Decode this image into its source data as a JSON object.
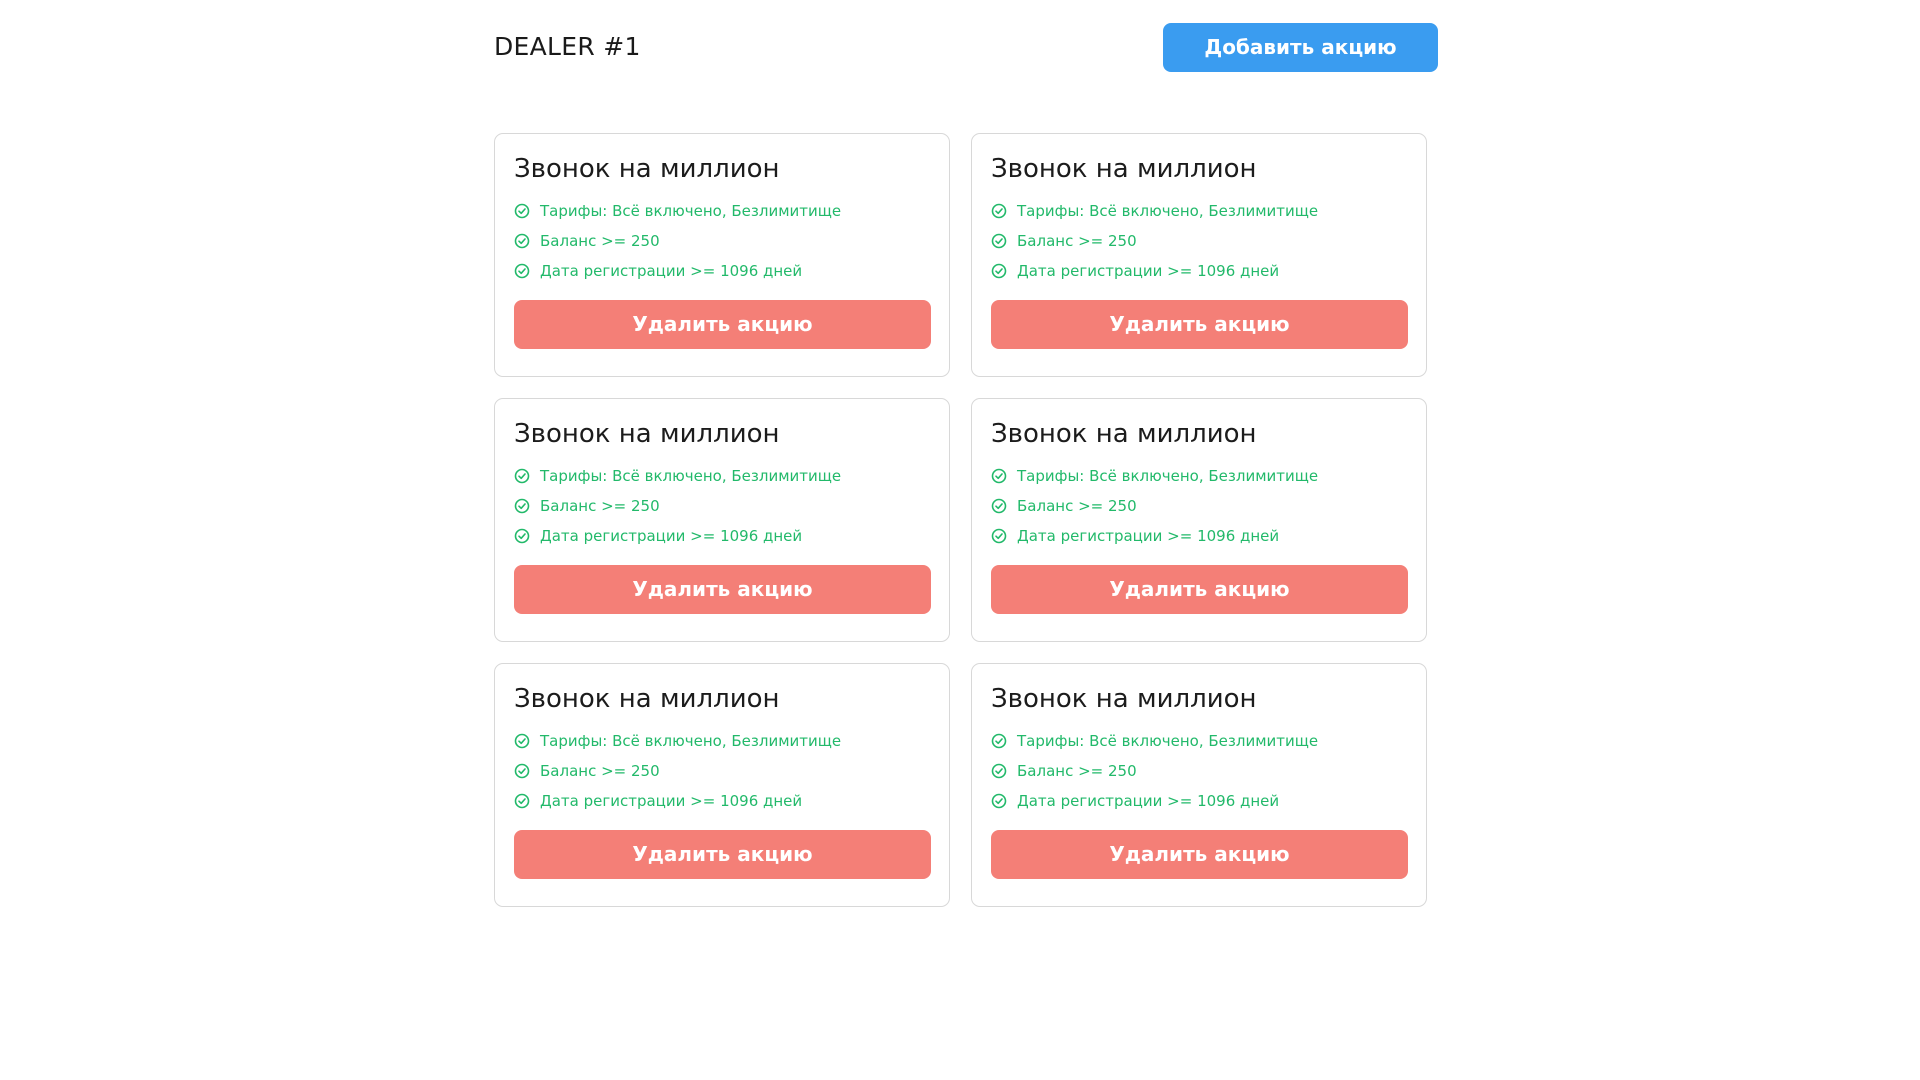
{
  "header": {
    "title": "DEALER #1",
    "add_button_label": "Добавить акцию"
  },
  "colors": {
    "add_button": "#3a9cf0",
    "delete_button": "#f47f77",
    "condition_text": "#22b96a",
    "card_border": "#d8d8d8"
  },
  "promotions": [
    {
      "title": "Звонок на миллион",
      "conditions": [
        "Тарифы: Всё включено, Безлимитище",
        "Баланс >= 250",
        "Дата регистрации >= 1096 дней"
      ],
      "delete_label": "Удалить акцию"
    },
    {
      "title": "Звонок на миллион",
      "conditions": [
        "Тарифы: Всё включено, Безлимитище",
        "Баланс >= 250",
        "Дата регистрации >= 1096 дней"
      ],
      "delete_label": "Удалить акцию"
    },
    {
      "title": "Звонок на миллион",
      "conditions": [
        "Тарифы: Всё включено, Безлимитище",
        "Баланс >= 250",
        "Дата регистрации >= 1096 дней"
      ],
      "delete_label": "Удалить акцию"
    },
    {
      "title": "Звонок на миллион",
      "conditions": [
        "Тарифы: Всё включено, Безлимитище",
        "Баланс >= 250",
        "Дата регистрации >= 1096 дней"
      ],
      "delete_label": "Удалить акцию"
    },
    {
      "title": "Звонок на миллион",
      "conditions": [
        "Тарифы: Всё включено, Безлимитище",
        "Баланс >= 250",
        "Дата регистрации >= 1096 дней"
      ],
      "delete_label": "Удалить акцию"
    },
    {
      "title": "Звонок на миллион",
      "conditions": [
        "Тарифы: Всё включено, Безлимитище",
        "Баланс >= 250",
        "Дата регистрации >= 1096 дней"
      ],
      "delete_label": "Удалить акцию"
    }
  ]
}
